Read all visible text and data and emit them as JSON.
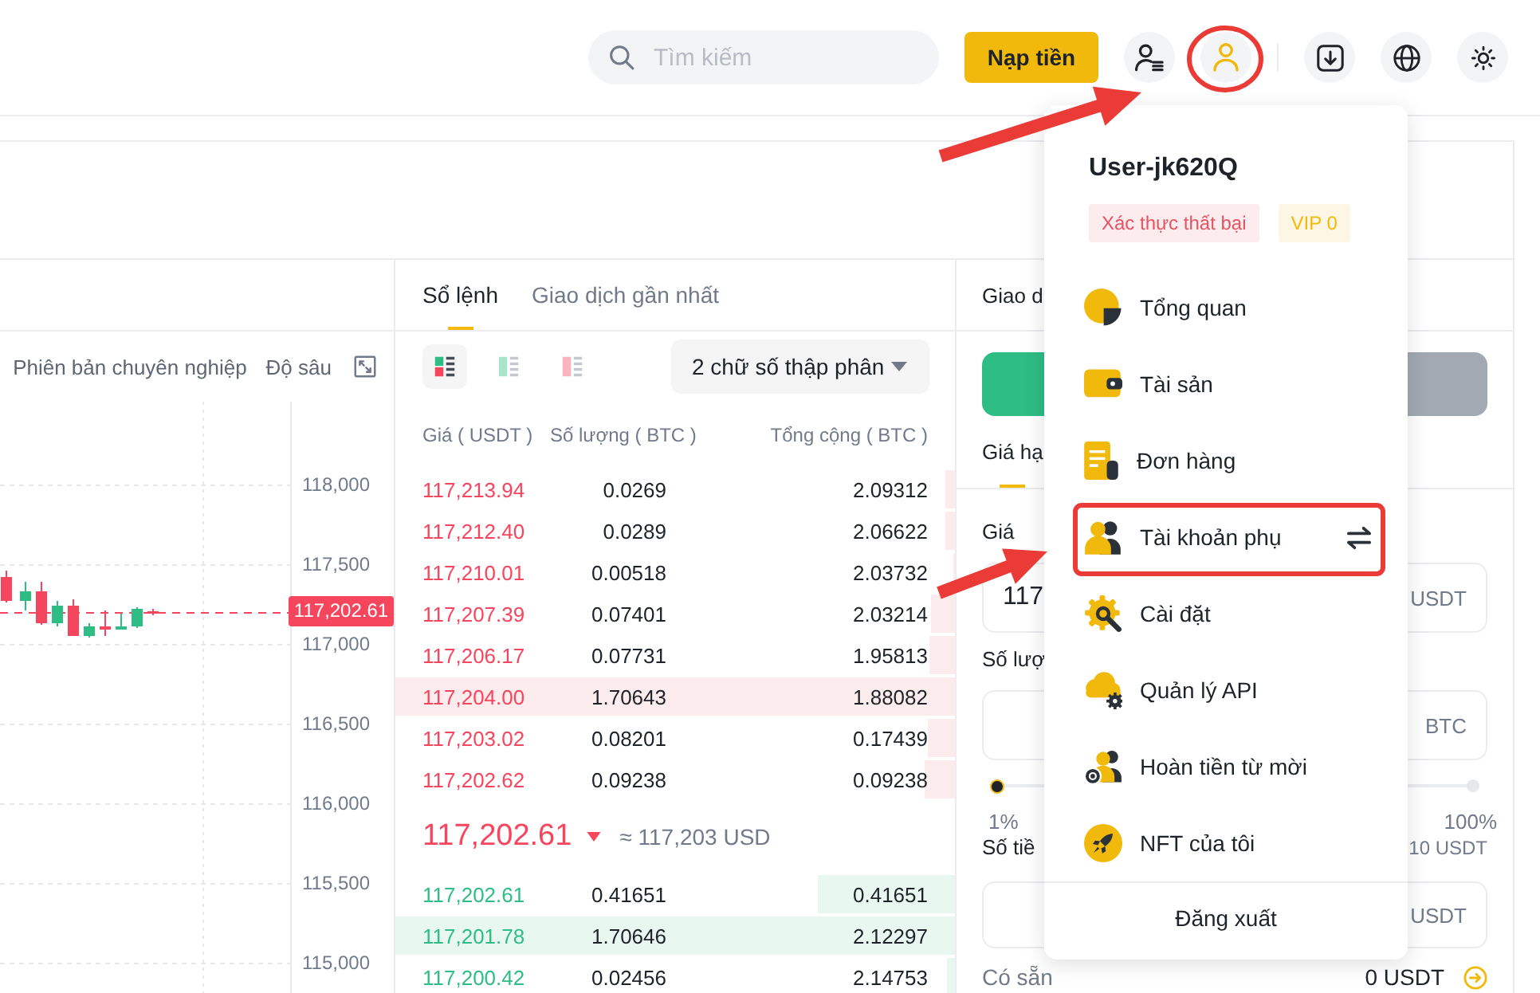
{
  "header": {
    "search": {
      "placeholder": "Tìm kiếm"
    },
    "deposit_button": "Nạp tiền",
    "account_buttons": [
      {
        "kind": "user-list",
        "selected": false
      },
      {
        "kind": "user",
        "selected": true
      }
    ],
    "tool_buttons": [
      {
        "kind": "download"
      },
      {
        "kind": "globe"
      },
      {
        "kind": "sun"
      }
    ]
  },
  "chart": {
    "views": [
      "Phiên bản chuyên nghiệp",
      "Độ sâu"
    ],
    "price_axis": [
      "118,000",
      "117,500",
      "117,000",
      "116,500",
      "116,000",
      "115,500",
      "115,000"
    ],
    "last_price": "117,202.61"
  },
  "order_book": {
    "tabs": [
      {
        "label": "Sổ lệnh",
        "selected": true
      },
      {
        "label": "Giao dịch gần nhất",
        "selected": false
      }
    ],
    "view_modes": [
      {
        "kind": "both",
        "selected": true
      },
      {
        "kind": "bids",
        "selected": false
      },
      {
        "kind": "asks",
        "selected": false
      }
    ],
    "precision": "2 chữ số thập phân",
    "columns": [
      "Giá ( USDT )",
      "Số lượng ( BTC )",
      "Tổng cộng ( BTC )"
    ],
    "asks": [
      {
        "price": "117,213.94",
        "amount": "0.0269",
        "total": "2.09312",
        "level": 0.016
      },
      {
        "price": "117,212.40",
        "amount": "0.0289",
        "total": "2.06622",
        "level": 0.017
      },
      {
        "price": "117,210.01",
        "amount": "0.00518",
        "total": "2.03732",
        "level": 0.003
      },
      {
        "price": "117,207.39",
        "amount": "0.07401",
        "total": "2.03214",
        "level": 0.043
      },
      {
        "price": "117,206.17",
        "amount": "0.07731",
        "total": "1.95813",
        "level": 0.045
      },
      {
        "price": "117,204.00",
        "amount": "1.70643",
        "total": "1.88082",
        "level": 1
      },
      {
        "price": "117,203.02",
        "amount": "0.08201",
        "total": "0.17439",
        "level": 0.048
      },
      {
        "price": "117,202.62",
        "amount": "0.09238",
        "total": "0.09238",
        "level": 0.054
      }
    ],
    "last_price": "117,202.61",
    "price_falling": true,
    "usd_price": "≈ 117,203 USD",
    "bids": [
      {
        "price": "117,202.61",
        "amount": "0.41651",
        "total": "0.41651",
        "level": 0.244
      },
      {
        "price": "117,201.78",
        "amount": "1.70646",
        "total": "2.12297",
        "level": 1
      },
      {
        "price": "117,200.42",
        "amount": "0.02456",
        "total": "2.14753",
        "level": 0.014
      }
    ]
  },
  "trade_panel": {
    "tab": "Giao d",
    "sides": [
      {
        "kind": "buy",
        "selected": true
      },
      {
        "kind": "sell",
        "selected": false
      }
    ],
    "order_types": [
      {
        "label": "Giá hạ",
        "selected": true
      }
    ],
    "price": {
      "label": "Giá",
      "value": "117",
      "unit": "USDT"
    },
    "amount": {
      "label": "Số lượ",
      "unit": "BTC"
    },
    "slider": {
      "level": 0,
      "min_label": "1%",
      "max_label": "100%"
    },
    "total": {
      "label": "Số tiề",
      "note": "10 USDT",
      "unit": "USDT"
    },
    "available": {
      "label": "Có sẵn",
      "value": "0 USDT"
    }
  },
  "account_menu": {
    "username": "User-jk620Q",
    "badges": [
      {
        "label": "Xác thực thất bại",
        "kind": "error"
      },
      {
        "label": "VIP 0",
        "kind": "vip"
      }
    ],
    "items": [
      {
        "label": "Tổng quan",
        "kind": "overview",
        "switch": false
      },
      {
        "label": "Tài sản",
        "kind": "wallet",
        "switch": false
      },
      {
        "label": "Đơn hàng",
        "kind": "orders",
        "switch": false
      },
      {
        "label": "Tài khoản phụ",
        "kind": "sub-account",
        "switch": true
      },
      {
        "label": "Cài đặt",
        "kind": "settings",
        "switch": false
      },
      {
        "label": "Quản lý API",
        "kind": "api",
        "switch": false
      },
      {
        "label": "Hoàn tiền từ mời",
        "kind": "referral",
        "switch": false
      },
      {
        "label": "NFT của tôi",
        "kind": "nft",
        "switch": false
      }
    ],
    "logout": "Đăng xuất"
  }
}
